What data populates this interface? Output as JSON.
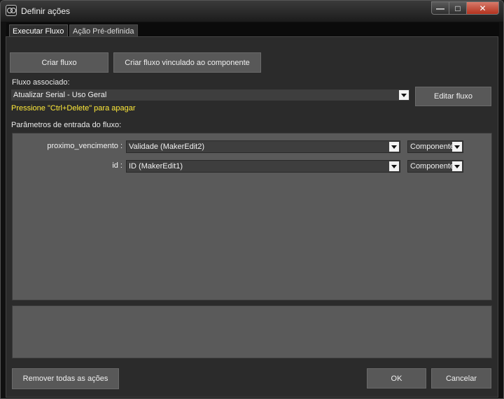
{
  "window": {
    "title": "Definir ações",
    "icon": "app-logo-icon",
    "controls": {
      "minimize": "—",
      "maximize": "□",
      "close": "✕"
    }
  },
  "tabs": [
    {
      "label": "Executar Fluxo",
      "active": true
    },
    {
      "label": "Ação Pré-definida",
      "active": false
    }
  ],
  "buttons": {
    "create_flow": "Criar fluxo",
    "create_linked_flow": "Criar fluxo vinculado ao componente",
    "edit_flow": "Editar fluxo",
    "remove_all": "Remover todas as ações",
    "ok": "OK",
    "cancel": "Cancelar"
  },
  "flow": {
    "label": "Fluxo associado:",
    "selected": "Atualizar Serial - Uso Geral",
    "hint": "Pressione \"Ctrl+Delete\" para apagar"
  },
  "params": {
    "label": "Parâmetros de entrada do fluxo:",
    "rows": [
      {
        "name": "proximo_vencimento :",
        "value": "Validade (MakerEdit2)",
        "type": "Componente"
      },
      {
        "name": "id :",
        "value": "ID (MakerEdit1)",
        "type": "Componente"
      }
    ]
  },
  "colors": {
    "hint": "#ffea3a",
    "close_button": "#c0402a"
  }
}
